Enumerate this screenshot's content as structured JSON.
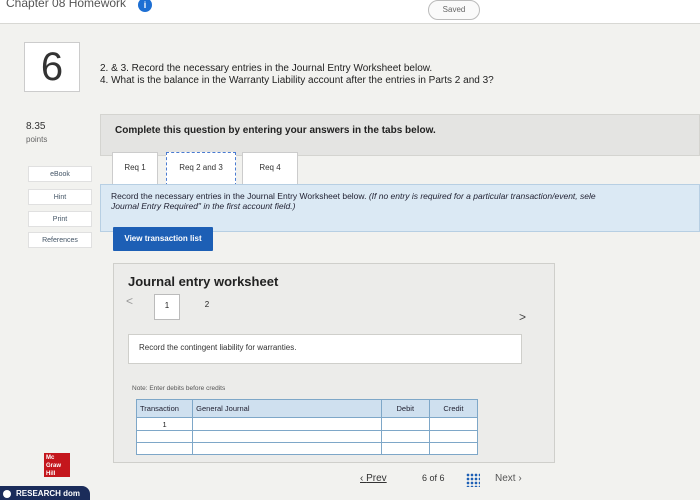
{
  "topbar": {
    "breadcrumb": "Chapter 08 Homework",
    "badge": "i",
    "saved": "Saved"
  },
  "question": {
    "number": "6",
    "points_value": "8.35",
    "points_label": "points",
    "line1": "2. & 3. Record the necessary entries in the Journal Entry Worksheet below.",
    "line2": "4. What is the balance in the Warranty Liability account after the entries in Parts 2 and 3?"
  },
  "sidebar": {
    "ebook": "eBook",
    "hint": "Hint",
    "print": "Print",
    "references": "References"
  },
  "logo": {
    "line1": "Mc",
    "line2": "Graw",
    "line3": "Hill"
  },
  "research": "RESEARCH dom",
  "complete_text": "Complete this question by entering your answers in the tabs below.",
  "tabs": [
    "Req 1",
    "Req 2 and 3",
    "Req 4"
  ],
  "instruction": {
    "main": "Record the necessary entries in the Journal Entry Worksheet below.",
    "note": "(If no entry is required for a particular transaction/event, sele",
    "note2": "Journal Entry Required\" in the first account field.)"
  },
  "view_button": "View transaction list",
  "worksheet": {
    "title": "Journal entry worksheet",
    "page_active": "1",
    "page_other": "2",
    "description": "Record the contingent liability for warranties.",
    "note": "Note: Enter debits before credits",
    "headers": [
      "Transaction",
      "General Journal",
      "Debit",
      "Credit"
    ],
    "row_transaction": "1"
  },
  "footer": {
    "prev": "Prev",
    "count": "6 of 6",
    "next": "Next"
  }
}
